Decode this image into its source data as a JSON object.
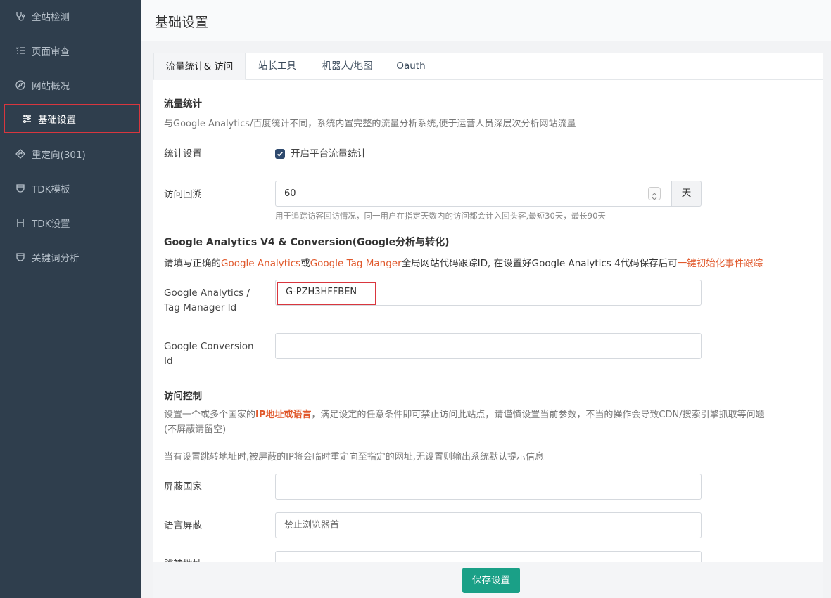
{
  "sidebar": {
    "items": [
      {
        "label": "全站检测",
        "icon": "stethoscope-icon"
      },
      {
        "label": "页面审查",
        "icon": "list-check-icon"
      },
      {
        "label": "网站概况",
        "icon": "compass-icon"
      },
      {
        "label": "基础设置",
        "icon": "sliders-icon"
      },
      {
        "label": "重定向(301)",
        "icon": "diamond-arrow-icon"
      },
      {
        "label": "TDK模板",
        "icon": "shield-icon"
      },
      {
        "label": "TDK设置",
        "icon": "heading-icon"
      },
      {
        "label": "关键词分析",
        "icon": "shield-icon"
      }
    ]
  },
  "header": {
    "title": "基础设置"
  },
  "tabs": [
    {
      "label": "流量统计& 访问"
    },
    {
      "label": "站长工具"
    },
    {
      "label": "机器人/地图"
    },
    {
      "label": "Oauth"
    }
  ],
  "traffic": {
    "title": "流量统计",
    "desc": "与Google Analytics/百度统计不同，系统内置完整的流量分析系统,便于运营人员深层次分析网站流量",
    "stat_label": "统计设置",
    "stat_checkbox_label": "开启平台流量统计",
    "revisit_label": "访问回溯",
    "revisit_value": "60",
    "revisit_unit": "天",
    "revisit_help": "用于追踪访客回访情况，同一用户在指定天数内的访问都会计入回头客,最短30天，最长90天"
  },
  "ga": {
    "title": "Google Analytics V4 & Conversion(Google分析与转化)",
    "desc_1": "请填写正确的",
    "desc_link_1": "Google Analytics",
    "desc_2": "或",
    "desc_link_2": "Google Tag Manger",
    "desc_3": "全局网站代码跟踪ID, 在设置好Google Analytics 4代码保存后可",
    "desc_link_3": "一键初始化事件跟踪",
    "ga_label_line1": "Google Analytics /",
    "ga_label_line2": "Tag Manager Id",
    "ga_value": "G-PZH3HFFBEN",
    "conv_label_line1": "Google Conversion",
    "conv_label_line2": "Id",
    "conv_value": ""
  },
  "access": {
    "title": "访问控制",
    "desc_1": "设置一个或多个国家的",
    "desc_bold": "IP地址或语言",
    "desc_2": "，满足设定的任意条件即可禁止访问此站点，请谨慎设置当前参数，不当的操作会导致CDN/搜索引擎抓取等问题",
    "desc_3": "(不屏蔽请留空)",
    "redirect_note": "当有设置跳转地址时,被屏蔽的IP将会临时重定向至指定的网址,无设置则输出系统默认提示信息",
    "country_label": "屏蔽国家",
    "country_value": "",
    "lang_label": "语言屏蔽",
    "lang_placeholder": "禁止浏览器首",
    "jump_label": "跳转地址"
  },
  "footer": {
    "save_label": "保存设置"
  },
  "colors": {
    "sidebar_bg": "#2f3e4d",
    "accent_green": "#1aa087",
    "link_orange": "#e0582b",
    "highlight_red": "#d9363e"
  }
}
